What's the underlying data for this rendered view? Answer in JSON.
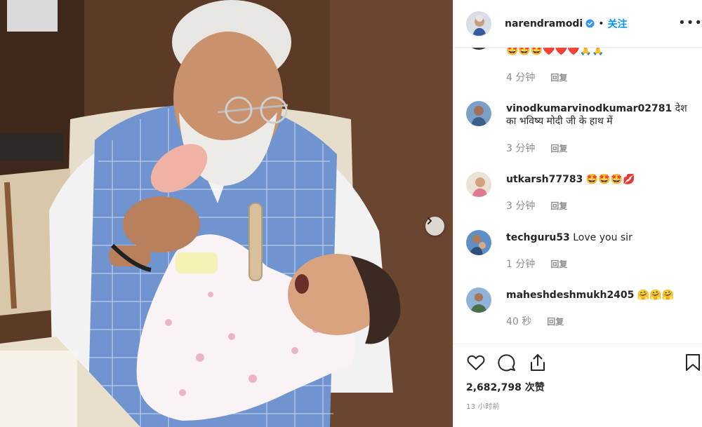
{
  "post": {
    "username": "narendramodi",
    "separator": "•",
    "follow_label": "关注",
    "more_icon": "more-horizontal-icon"
  },
  "comments": [
    {
      "user": "",
      "body": "🤩🤩🤩❤️❤️❤️🙏🙏",
      "time": "4 分钟",
      "reply": "回复"
    },
    {
      "user": "vinodkumarvinodkumar02781",
      "body": "देश का भविष्य मोदी जी के हाथ में",
      "time": "3 分钟",
      "reply": "回复"
    },
    {
      "user": "utkarsh77783",
      "body": "🤩🤩🤩💋",
      "time": "3 分钟",
      "reply": "回复"
    },
    {
      "user": "techguru53",
      "body": "Love you sir",
      "time": "1 分钟",
      "reply": "回复"
    },
    {
      "user": "maheshdeshmukh2405",
      "body": "🤗🤗🤗",
      "time": "40 秒",
      "reply": "回复"
    }
  ],
  "footer": {
    "likes": "2,682,798 次赞",
    "time_ago": "13 小时前"
  },
  "colors": {
    "link": "#0095f6",
    "secondary_text": "#8e8e8e",
    "border": "#efefef"
  }
}
